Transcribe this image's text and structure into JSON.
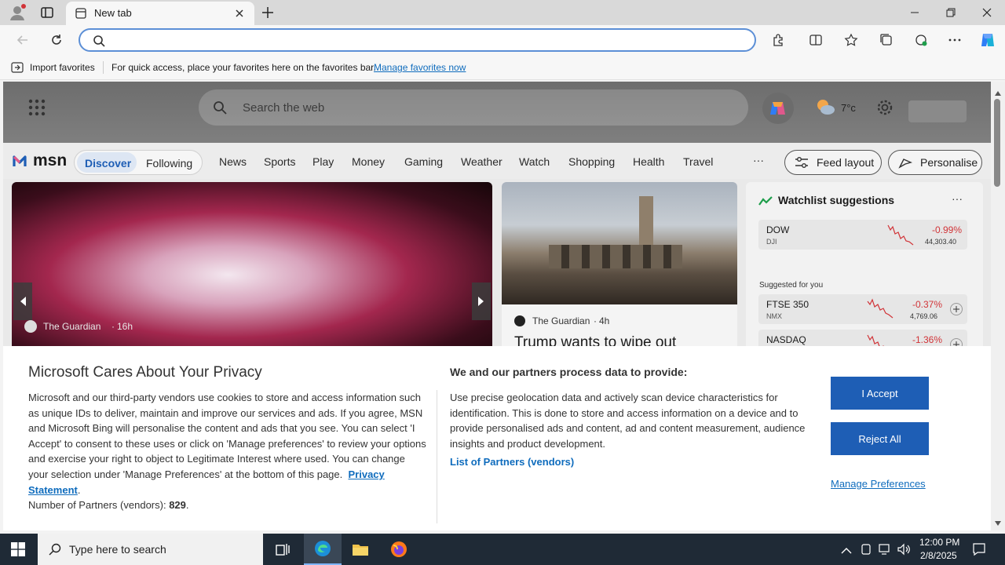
{
  "browser": {
    "tab_title": "New tab",
    "address_placeholder": ""
  },
  "favbar": {
    "import_label": "Import favorites",
    "hint": "For quick access, place your favorites here on the favorites bar.",
    "manage_link": "Manage favorites now"
  },
  "msn": {
    "search_placeholder": "Search the web",
    "weather_temp": "7°c",
    "logo_text": "msn",
    "tabs": [
      "Discover",
      "Following"
    ],
    "nav": [
      "News",
      "Sports",
      "Play",
      "Money",
      "Gaming",
      "Weather",
      "Watch",
      "Shopping",
      "Health",
      "Travel"
    ],
    "more": "···",
    "feed_layout": "Feed layout",
    "personalise": "Personalise"
  },
  "hero": {
    "source": "The Guardian",
    "age": "16h"
  },
  "card2": {
    "source": "The Guardian",
    "age": "4h",
    "headline": "Trump wants to wipe out"
  },
  "watchlist": {
    "title": "Watchlist suggestions",
    "more": "···",
    "suggested_label": "Suggested for you",
    "items": [
      {
        "name": "DOW",
        "sub": "DJI",
        "change": "-0.99%",
        "price": "44,303.40"
      },
      {
        "name": "FTSE 350",
        "sub": "NMX",
        "change": "-0.37%",
        "price": "4,769.06"
      },
      {
        "name": "NASDAQ",
        "sub": "",
        "change": "-1.36%",
        "price": ""
      }
    ]
  },
  "privacy": {
    "title": "Microsoft Cares About Your Privacy",
    "body": "Microsoft and our third-party vendors use cookies to store and access information such as unique IDs to deliver, maintain and improve our services and ads. If you agree, MSN and Microsoft Bing will personalise the content and ads that you see. You can select 'I Accept' to consent to these uses or click on 'Manage preferences' to review your options and exercise your right to object to Legitimate Interest where used.  You can change your selection under 'Manage Preferences' at the bottom of this page.",
    "privacy_link": "Privacy Statement",
    "partners_count_label": "Number of Partners (vendors):",
    "partners_count": "829",
    "right_title": "We and our partners process data to provide:",
    "right_body": "Use precise geolocation data and actively scan device characteristics for identification. This is done to store and access information on a device and to provide personalised ads and content, ad and content measurement, audience insights and product development.",
    "partners_link": "List of Partners (vendors)",
    "accept": "I Accept",
    "reject": "Reject All",
    "manage": "Manage Preferences"
  },
  "taskbar": {
    "search_placeholder": "Type here to search",
    "time": "12:00 PM",
    "date": "2/8/2025"
  },
  "colors": {
    "accent": "#1e5eb5",
    "link": "#0f6cbd",
    "negative": "#d13438"
  }
}
